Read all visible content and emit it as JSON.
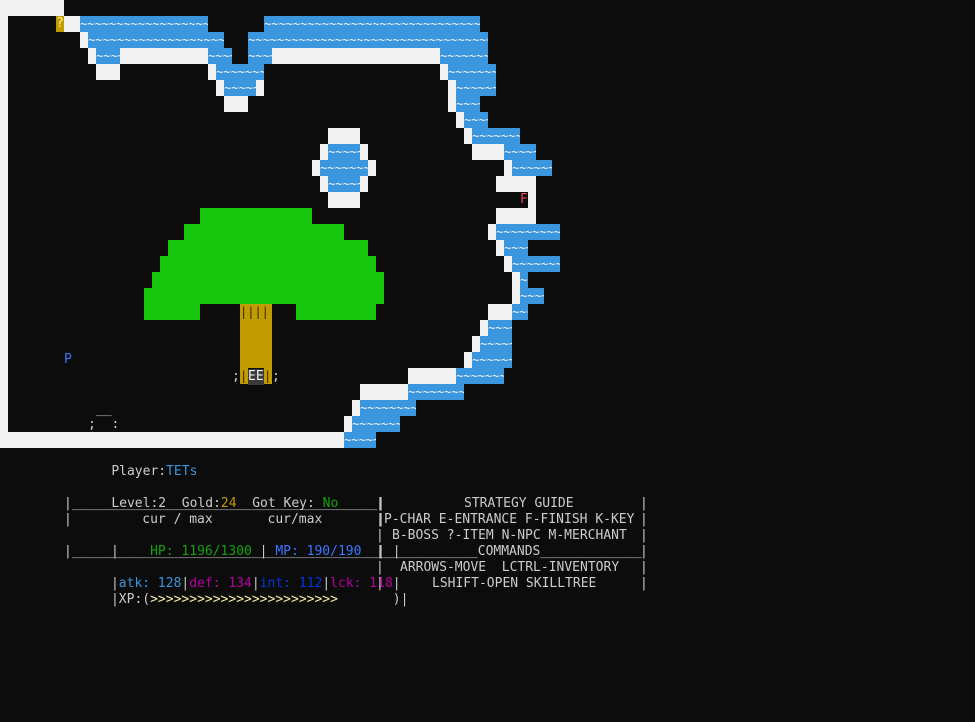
{
  "map": {
    "item_marker": "?",
    "finish_marker": "F",
    "player_marker": "P",
    "entrance_marker": "EE",
    "entrance_left": ";",
    "entrance_right": ";",
    "merchant_top": "__",
    "merchant_bottom": ";  :",
    "wave_text": "~~~~~~~~~~~~~~~~~~~~~~~~~~~~~~~~~~~~~~~",
    "trunk_text": "||||||||||||||||||||||||||||||||||||||||||||"
  },
  "colors": {
    "water": "#3a96dd",
    "wall": "#f2f2f2",
    "tree": "#16c60c",
    "trunk": "#c19c00",
    "item": "#f9f1a5",
    "finish": "#e74856",
    "player": "#3b78ff",
    "gold": "#c19c00",
    "key": "#13a10e",
    "hp": "#13a10e",
    "mp": "#3b78ff",
    "atk": "#3a96dd",
    "def": "#b4009e",
    "int": "#0037da",
    "lck": "#b4009e",
    "xp": "#f9f1a5"
  },
  "hud": {
    "player_label": "Player:",
    "player_name": "TETs",
    "level_label": "Level:",
    "level_value": "2",
    "gold_label": "Gold:",
    "gold_value": "24",
    "key_label": "Got Key:",
    "key_value": "No",
    "stats_top_rule": "|_______________________________________|",
    "header_line": "|         cur / max       cur/max       |",
    "hp_line": "HP: 1196/1300",
    "mp_line": "MP: 190/190",
    "blank_line": "|                                       |",
    "stats_mid_rule": "|_______________________________________|",
    "atk": "atk: 128",
    "def": "def: 134",
    "int": "int: 112",
    "lck": "lck: 118",
    "xp_prefix": "|XP:(",
    "xp_bar": ">>>>>>>>>>>>>>>>>>>>>>>>",
    "xp_suffix": ")|"
  },
  "guide": {
    "title": "STRATEGY GUIDE",
    "line1": "P-CHAR E-ENTRANCE F-FINISH K-KEY",
    "line2": "B-BOSS ?-ITEM N-NPC M-MERCHANT",
    "commands_rule": "_____________COMMANDS_____________",
    "line3": "ARROWS-MOVE  LCTRL-INVENTORY",
    "line4": "LSHIFT-OPEN SKILLTREE"
  }
}
